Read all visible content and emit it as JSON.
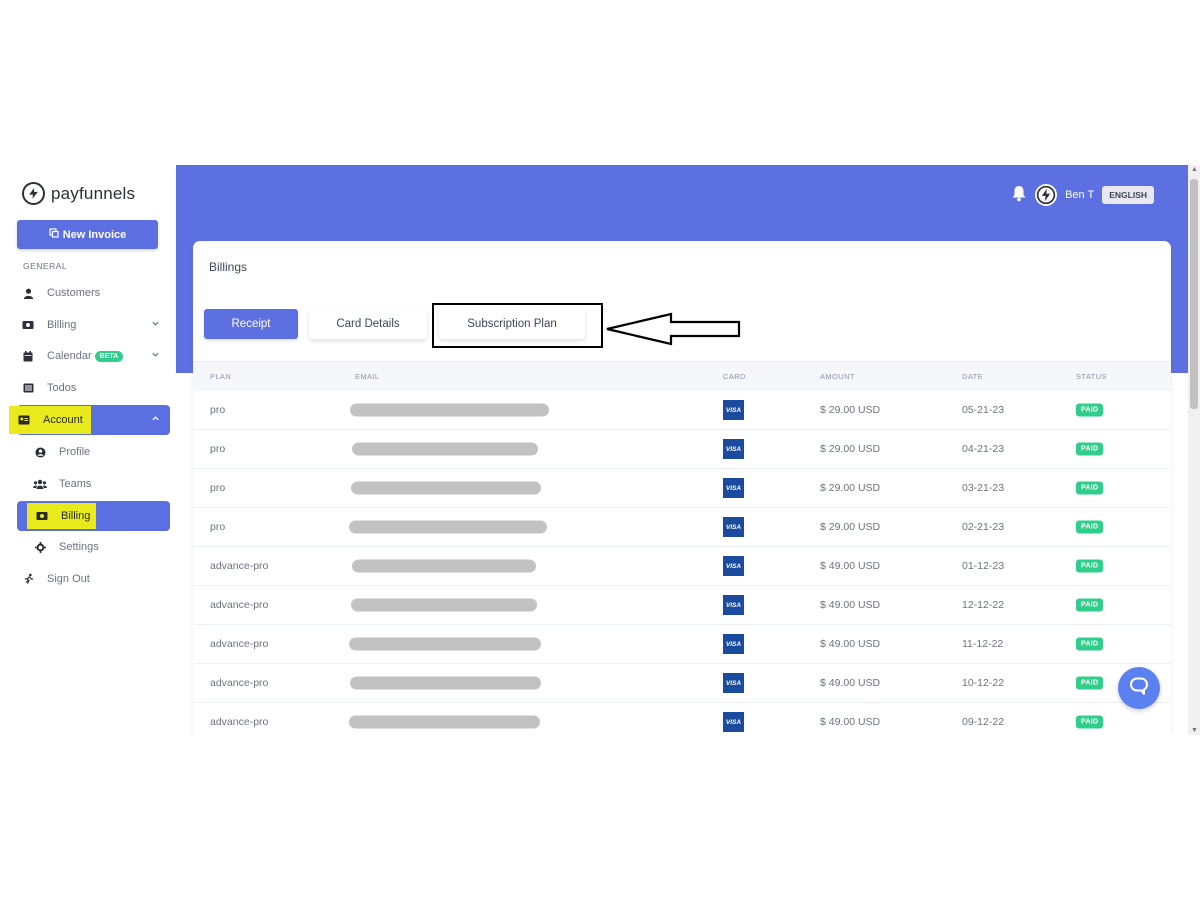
{
  "brand": {
    "name": "payfunnels"
  },
  "sidebar": {
    "new_invoice": "New Invoice",
    "section_label": "GENERAL",
    "items": [
      {
        "label": "Customers",
        "icon": "user-icon"
      },
      {
        "label": "Billing",
        "icon": "money-icon"
      },
      {
        "label": "Calendar",
        "icon": "calendar-icon",
        "badge": "BETA"
      },
      {
        "label": "Todos",
        "icon": "list-icon"
      },
      {
        "label": "Account",
        "icon": "id-card-icon"
      },
      {
        "label": "Profile",
        "icon": "user-circle-icon"
      },
      {
        "label": "Teams",
        "icon": "users-icon"
      },
      {
        "label": "Billing",
        "icon": "money-icon"
      },
      {
        "label": "Settings",
        "icon": "gear-icon"
      },
      {
        "label": "Sign Out",
        "icon": "running-icon"
      }
    ]
  },
  "header": {
    "user_name": "Ben T",
    "language": "ENGLISH"
  },
  "page": {
    "title": "Billings",
    "tabs": [
      "Receipt",
      "Card Details",
      "Subscription Plan"
    ],
    "active_tab": "Receipt"
  },
  "table": {
    "columns": [
      "PLAN",
      "EMAIL",
      "CARD",
      "AMOUNT",
      "DATE",
      "STATUS"
    ],
    "rows": [
      {
        "plan": "pro",
        "card": "VISA",
        "amount": "$ 29.00 USD",
        "date": "05-21-23",
        "status": "PAID"
      },
      {
        "plan": "pro",
        "card": "VISA",
        "amount": "$ 29.00 USD",
        "date": "04-21-23",
        "status": "PAID"
      },
      {
        "plan": "pro",
        "card": "VISA",
        "amount": "$ 29.00 USD",
        "date": "03-21-23",
        "status": "PAID"
      },
      {
        "plan": "pro",
        "card": "VISA",
        "amount": "$ 29.00 USD",
        "date": "02-21-23",
        "status": "PAID"
      },
      {
        "plan": "advance-pro",
        "card": "VISA",
        "amount": "$ 49.00 USD",
        "date": "01-12-23",
        "status": "PAID"
      },
      {
        "plan": "advance-pro",
        "card": "VISA",
        "amount": "$ 49.00 USD",
        "date": "12-12-22",
        "status": "PAID"
      },
      {
        "plan": "advance-pro",
        "card": "VISA",
        "amount": "$ 49.00 USD",
        "date": "11-12-22",
        "status": "PAID"
      },
      {
        "plan": "advance-pro",
        "card": "VISA",
        "amount": "$ 49.00 USD",
        "date": "10-12-22",
        "status": "PAID"
      },
      {
        "plan": "advance-pro",
        "card": "VISA",
        "amount": "$ 49.00 USD",
        "date": "09-12-22",
        "status": "PAID"
      }
    ]
  },
  "colors": {
    "accent": "#5b6fe0",
    "header_bg": "#5d70e1",
    "paid_badge": "#2fce8b",
    "highlight": "#e8ea1c",
    "visa_blue": "#1a4b9e"
  }
}
